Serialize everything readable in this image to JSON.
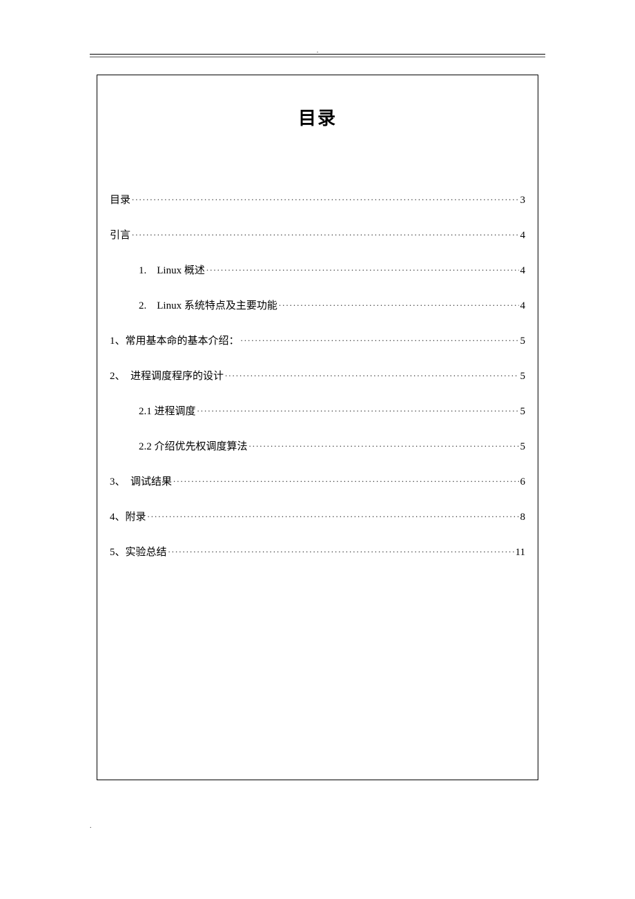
{
  "header_mark": ".",
  "footer_mark": ".",
  "title": "目录",
  "toc": [
    {
      "label": "目录",
      "page": "3",
      "indent": 0
    },
    {
      "label": "引言",
      "page": "4",
      "indent": 0
    },
    {
      "label": "1. Linux 概述",
      "page": "4",
      "indent": 1
    },
    {
      "label": "2. Linux 系统特点及主要功能",
      "page": "4",
      "indent": 1
    },
    {
      "label": "1、常用基本命的基本介绍：",
      "page": "5",
      "indent": 0
    },
    {
      "label": "2、 进程调度程序的设计",
      "page": "5",
      "indent": 0
    },
    {
      "label": "2.1 进程调度",
      "page": "5",
      "indent": 1
    },
    {
      "label": "2.2 介绍优先权调度算法",
      "page": "5",
      "indent": 1
    },
    {
      "label": "3、 调试结果",
      "page": "6",
      "indent": 0
    },
    {
      "label": "4、附录",
      "page": "8",
      "indent": 0
    },
    {
      "label": "5、实验总结",
      "page": "11",
      "indent": 0
    }
  ]
}
